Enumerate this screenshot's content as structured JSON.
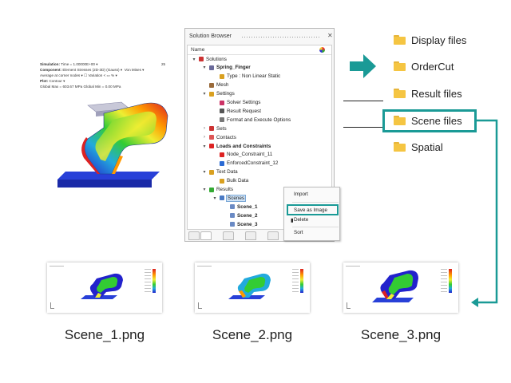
{
  "contour_panel": {
    "simulation_label": "Simulation:",
    "simulation_value": "Time = 1.00000E+00",
    "frame_number": "25",
    "component_label": "Component:",
    "component_value": "Element Stresses (2D-3D) (Gauss)",
    "component_extra": "Von Mises",
    "averaging": "Average at corner nodes",
    "variation_label": "Variation <",
    "variation_value": "%",
    "plot_label": "Plot:",
    "plot_value": "Contour",
    "global_range": "Global Max = 603.67 MPa  Global Min = 0.00 MPa"
  },
  "browser": {
    "title": "Solution Browser",
    "close_glyph": "✕",
    "column_header": "Name",
    "tree": [
      {
        "label": "Solutions",
        "bold": false,
        "indent": 0,
        "twisty": "▾",
        "icon": "solutions-icon"
      },
      {
        "label": "Spring_Finger",
        "bold": true,
        "indent": 1,
        "twisty": "▾",
        "icon": "solver-icon"
      },
      {
        "label": "Type : Non Linear Static",
        "bold": false,
        "indent": 2,
        "twisty": "",
        "icon": "type-icon"
      },
      {
        "label": "Mesh",
        "bold": false,
        "indent": 1,
        "twisty": "",
        "icon": "mesh-icon"
      },
      {
        "label": "Settings",
        "bold": false,
        "indent": 1,
        "twisty": "▾",
        "icon": "settings-icon"
      },
      {
        "label": "Solver Settings",
        "bold": false,
        "indent": 2,
        "twisty": "",
        "icon": "solver-settings-icon"
      },
      {
        "label": "Result Request",
        "bold": false,
        "indent": 2,
        "twisty": "",
        "icon": "result-request-icon"
      },
      {
        "label": "Format and Execute Options",
        "bold": false,
        "indent": 2,
        "twisty": "",
        "icon": "format-icon"
      },
      {
        "label": "Sets",
        "bold": false,
        "indent": 1,
        "twisty": "›",
        "icon": "sets-icon"
      },
      {
        "label": "Contacts",
        "bold": false,
        "indent": 1,
        "twisty": "›",
        "icon": "contacts-icon"
      },
      {
        "label": "Loads and Constraints",
        "bold": true,
        "indent": 1,
        "twisty": "▾",
        "icon": "loads-icon"
      },
      {
        "label": "Node_Constraint_11",
        "bold": false,
        "indent": 2,
        "twisty": "",
        "icon": "constraint-icon"
      },
      {
        "label": "EnforcedConstraint_12",
        "bold": false,
        "indent": 2,
        "twisty": "",
        "icon": "enforced-icon"
      },
      {
        "label": "Text Data",
        "bold": false,
        "indent": 1,
        "twisty": "▾",
        "icon": "text-data-icon"
      },
      {
        "label": "Bulk Data",
        "bold": false,
        "indent": 2,
        "twisty": "",
        "icon": "bulk-data-icon"
      },
      {
        "label": "Results",
        "bold": false,
        "indent": 1,
        "twisty": "▾",
        "icon": "results-icon"
      },
      {
        "label": "Scenes",
        "bold": false,
        "indent": 2,
        "twisty": "▾",
        "icon": "scenes-icon",
        "selected": true
      },
      {
        "label": "Scene_1",
        "bold": true,
        "indent": 3,
        "twisty": "",
        "icon": "scene-icon"
      },
      {
        "label": "Scene_2",
        "bold": true,
        "indent": 3,
        "twisty": "",
        "icon": "scene-icon"
      },
      {
        "label": "Scene_3",
        "bold": true,
        "indent": 3,
        "twisty": "",
        "icon": "scene-icon"
      }
    ]
  },
  "context_menu": {
    "items": [
      "Import",
      "Save as Image",
      "Delete",
      "Sort"
    ]
  },
  "folders": [
    {
      "label": "Display files"
    },
    {
      "label": "OrderCut"
    },
    {
      "label": "Result files"
    },
    {
      "label": "Scene files"
    },
    {
      "label": "Spatial"
    }
  ],
  "thumbnails": [
    {
      "caption": "Scene_1.png"
    },
    {
      "caption": "Scene_2.png"
    },
    {
      "caption": "Scene_3.png"
    }
  ],
  "colors": {
    "accent": "#1a9a96",
    "folder": "#f5c542",
    "base_plate": "#2233cc"
  }
}
